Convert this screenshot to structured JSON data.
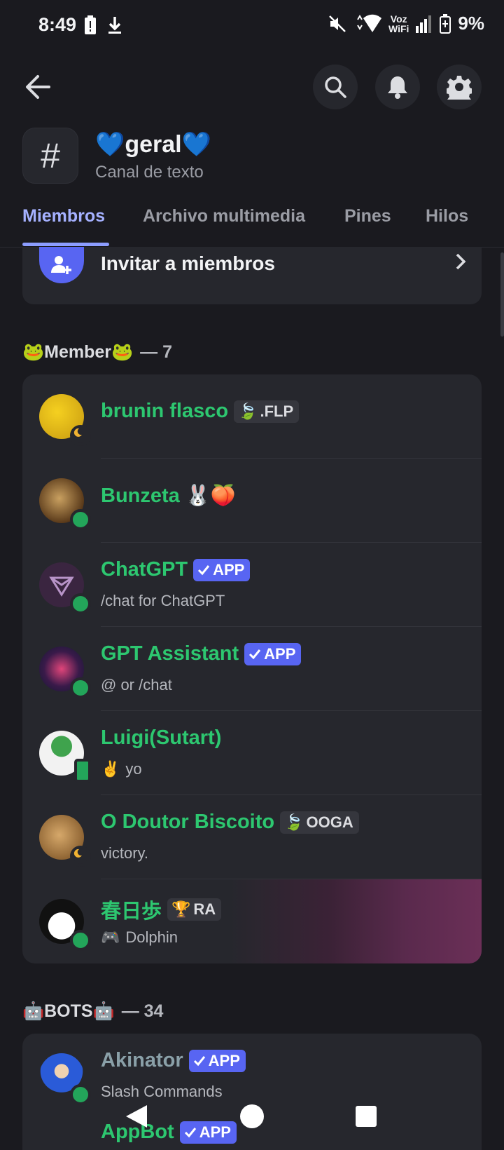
{
  "status_bar": {
    "time": "8:49",
    "voz_top": "Voz",
    "voz_bottom": "WiFi",
    "battery": "9%"
  },
  "header": {
    "channel_name": "💙geral💙",
    "channel_type": "Canal de texto"
  },
  "tabs": [
    "Miembros",
    "Archivo multimedia",
    "Pines",
    "Hilos"
  ],
  "invite": {
    "label": "Invitar a miembros"
  },
  "sections": [
    {
      "title": "🐸Member🐸",
      "count": "— 7"
    },
    {
      "title": "🤖BOTS🤖",
      "count": "— 34"
    }
  ],
  "members": [
    {
      "name": "brunin flasco",
      "tag": ".FLP",
      "tag_icon": "🍃",
      "sub": ""
    },
    {
      "name": "Bunzeta",
      "suffix": "🐰🍑",
      "sub": ""
    },
    {
      "name": "ChatGPT",
      "badge": "APP",
      "sub": "/chat for ChatGPT"
    },
    {
      "name": "GPT Assistant",
      "badge": "APP",
      "sub": "@ or /chat"
    },
    {
      "name": "Luigi(Sutart)",
      "sub_icon": "✌️",
      "sub": "yo"
    },
    {
      "name": "O Doutor Biscoito",
      "tag": "OOGA",
      "tag_icon": "🍃",
      "sub": "victory."
    },
    {
      "name": "春日歩",
      "tag": "RA",
      "tag_icon": "🏆",
      "sub_icon": "🎮",
      "sub": "Dolphin"
    }
  ],
  "bots": [
    {
      "name": "Akinator",
      "badge": "APP",
      "sub": "Slash Commands"
    },
    {
      "name": "AppBot",
      "badge": "APP"
    }
  ],
  "colors": {
    "background": "#1a1a1f",
    "card": "#26272d",
    "accent": "#5865f2",
    "member_name": "#2dc770",
    "active_tab": "#a5b1ff",
    "online": "#23a55a"
  }
}
